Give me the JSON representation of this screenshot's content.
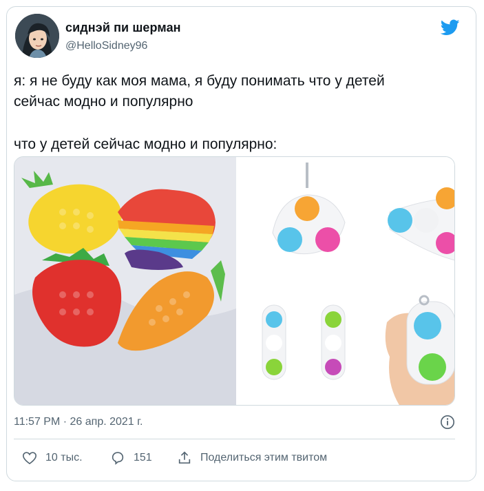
{
  "author": {
    "display_name": "сиднэй пи шерман",
    "handle": "@HelloSidney96"
  },
  "tweet": {
    "line1": "я: я не буду как моя мама, я буду понимать что у детей",
    "line2": "сейчас модно и популярно",
    "line3": "что у детей сейчас модно и популярно:"
  },
  "timestamp": "11:57 PM · 26 апр. 2021 г.",
  "actions": {
    "likes": "10 тыс.",
    "replies": "151",
    "share": "Поделиться этим твитом"
  },
  "icons": {
    "brand": "twitter-bird-icon",
    "info": "info-icon",
    "like": "heart-icon",
    "reply": "reply-icon",
    "share": "share-icon"
  },
  "colors": {
    "brand": "#1d9bf0",
    "secondary_text": "#536471",
    "border": "#cfd9de"
  }
}
